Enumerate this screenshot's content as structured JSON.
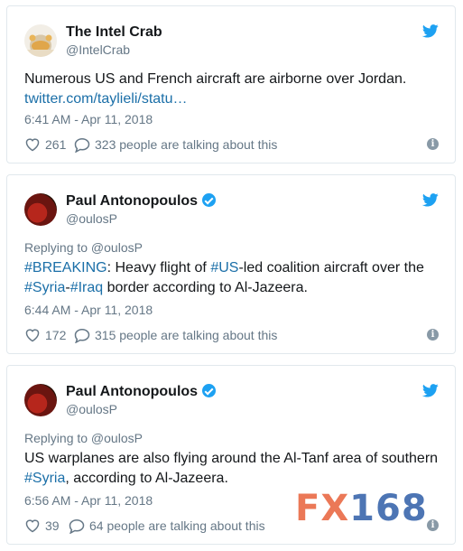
{
  "tweets": [
    {
      "name": "The Intel Crab",
      "handle": "@IntelCrab",
      "verified": false,
      "text": "Numerous US and French aircraft are airborne over Jordan.",
      "link": "twitter.com/taylieli/statu…",
      "time": "6:41 AM - Apr 11, 2018",
      "likes": "261",
      "talking": "323 people are talking about this"
    },
    {
      "name": "Paul Antonopoulos",
      "handle": "@oulosP",
      "verified": true,
      "replying": "Replying to @oulosP",
      "text_parts": [
        "#BREAKING",
        ": Heavy flight of ",
        "#US",
        "-led coalition aircraft over the",
        "#Syria",
        "-",
        "#Iraq",
        " border according to Al-Jazeera."
      ],
      "time": "6:44 AM - Apr 11, 2018",
      "likes": "172",
      "talking": "315 people are talking about this"
    },
    {
      "name": "Paul Antonopoulos",
      "handle": "@oulosP",
      "verified": true,
      "replying": "Replying to @oulosP",
      "text_parts": [
        "US warplanes are also flying around the Al-Tanf area of southern",
        "#Syria",
        ", according to Al-Jazeera."
      ],
      "time": "6:56 AM - Apr 11, 2018",
      "likes": "39",
      "talking": "64 people are talking about this"
    }
  ],
  "watermark": {
    "part1": "FX",
    "part2": "168"
  },
  "icons": {
    "bird": "twitter-bird-icon",
    "heart": "heart-icon",
    "bubble": "speech-bubble-icon",
    "info": "info-icon",
    "badge": "verified-badge-icon"
  },
  "colors": {
    "twitter_blue": "#1da1f2",
    "link": "#1b6fa8",
    "muted": "#657786",
    "watermark_orange": "#e8613a",
    "watermark_blue": "#2e5da8"
  }
}
